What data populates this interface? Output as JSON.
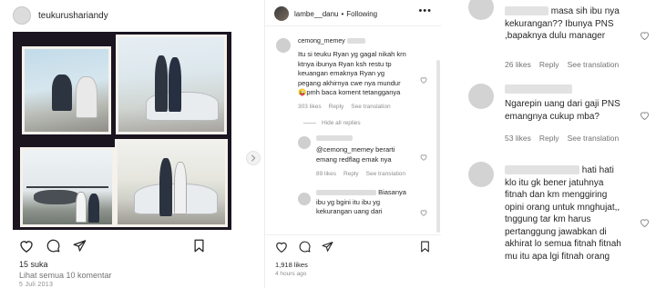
{
  "post": {
    "username": "teukurushariandy",
    "likes": "15 suka",
    "view_comments": "Lihat semua 10 komentar",
    "date": "5 Juli 2013"
  },
  "thread": {
    "username": "lambe__danu",
    "separator": "•",
    "follow_state": "Following",
    "more": "•••",
    "hide_replies": "Hide all replies",
    "likes": "1,918 likes",
    "time": "4 hours ago",
    "comments": [
      {
        "username": "cemong_memey",
        "lines": [
          "Itu si teuku Ryan yg gagal nikah krn",
          "ktnya ibunya Ryan ksh restu tp",
          "keuangan emaknya Ryan yg",
          "pegang akhirnya cwe nya mundur",
          "😜pmh baca koment tetangganya"
        ],
        "likes": "303 likes",
        "reply": "Reply",
        "translate": "See translation"
      },
      {
        "lines": [
          "@cemong_memey berarti",
          "emang redflag emak nya"
        ],
        "likes": "89 likes",
        "reply": "Reply",
        "translate": "See translation"
      },
      {
        "lines": [
          "Biasanya",
          "ibu yg bgini itu ibu yg",
          "kekurangan uang dari"
        ]
      }
    ]
  },
  "zoomed": {
    "comments": [
      {
        "lines": [
          "masa sih ibu nya",
          "kekurangan?? Ibunya PNS",
          ",bapaknya dulu manager"
        ],
        "likes": "26 likes",
        "reply": "Reply",
        "translate": "See translation"
      },
      {
        "lines": [
          "Ngarepin uang dari gaji PNS",
          "emangnya cukup mba?"
        ],
        "likes": "53 likes",
        "reply": "Reply",
        "translate": "See translation"
      },
      {
        "lines": [
          "hati hati",
          "klo itu gk bener jatuhnya",
          "fitnah dan km menggiring",
          "opini orang untuk mnghujat,,",
          "tnggung tar km harus",
          "pertanggung jawabkan di",
          "akhirat lo semua fitnah fitnah",
          "mu itu apa lgi fitnah orang"
        ]
      }
    ]
  },
  "colors": {
    "text": "#262626",
    "muted": "#8e8e8e",
    "bg": "#ffffff",
    "photo_bg": "#1b1520"
  },
  "icons": [
    "avatar",
    "heart-icon",
    "comment-icon",
    "share-icon",
    "bookmark-icon",
    "chevron-right-icon",
    "more-icon"
  ]
}
